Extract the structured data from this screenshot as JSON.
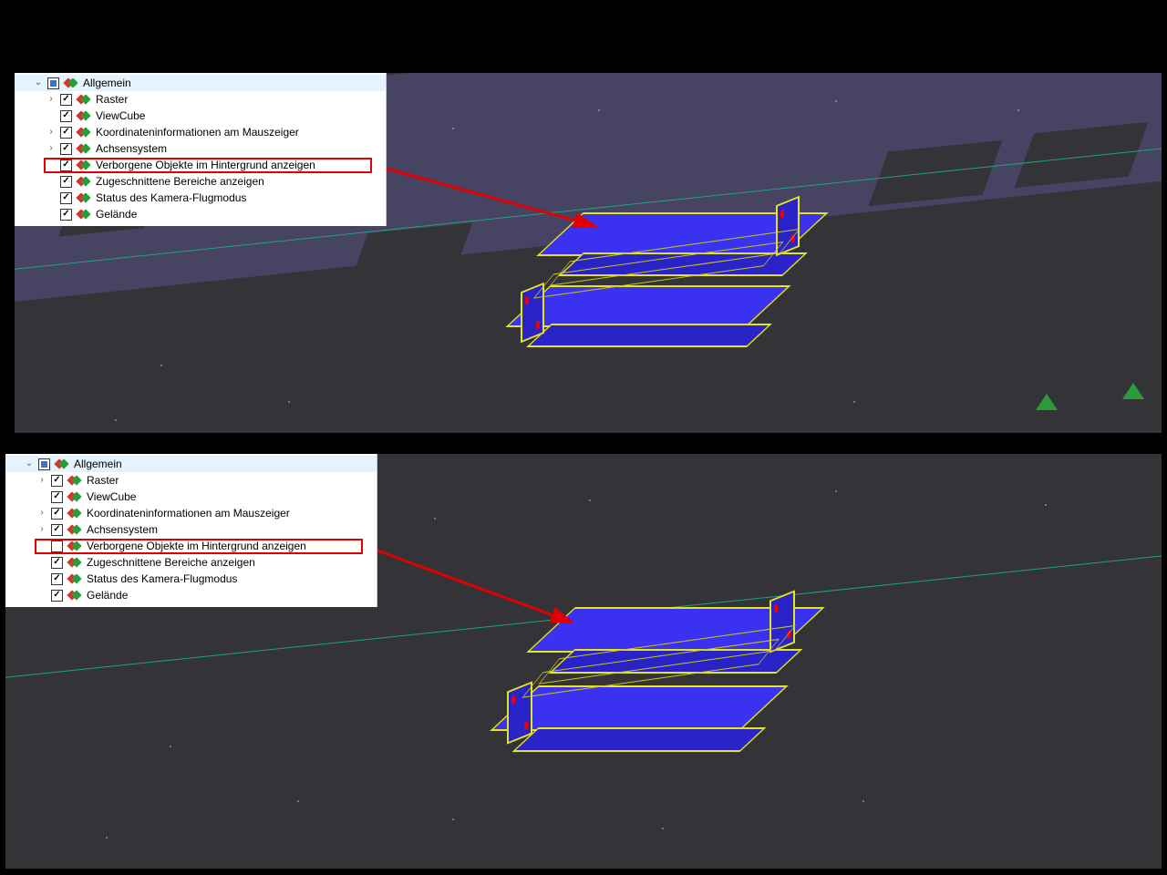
{
  "panels": [
    {
      "id": "top",
      "highlighted_item_index": 5,
      "highlighted_item_checked": true,
      "tree": {
        "root": {
          "label": "Allgemein",
          "checked": "partial"
        },
        "items": [
          {
            "label": "Raster",
            "checked": true,
            "expandable": true
          },
          {
            "label": "ViewCube",
            "checked": true,
            "expandable": false
          },
          {
            "label": "Koordinateninformationen am Mauszeiger",
            "checked": true,
            "expandable": true
          },
          {
            "label": "Achsensystem",
            "checked": true,
            "expandable": true
          },
          {
            "label": "Verborgene Objekte im Hintergrund anzeigen",
            "checked": true,
            "expandable": false
          },
          {
            "label": "Zugeschnittene Bereiche anzeigen",
            "checked": true,
            "expandable": false
          },
          {
            "label": "Status des Kamera-Flugmodus",
            "checked": true,
            "expandable": false
          },
          {
            "label": "Gelände",
            "checked": true,
            "expandable": false
          }
        ]
      }
    },
    {
      "id": "bottom",
      "highlighted_item_index": 5,
      "highlighted_item_checked": false,
      "tree": {
        "root": {
          "label": "Allgemein",
          "checked": "partial"
        },
        "items": [
          {
            "label": "Raster",
            "checked": true,
            "expandable": true
          },
          {
            "label": "ViewCube",
            "checked": true,
            "expandable": false
          },
          {
            "label": "Koordinateninformationen am Mauszeiger",
            "checked": true,
            "expandable": true
          },
          {
            "label": "Achsensystem",
            "checked": true,
            "expandable": true
          },
          {
            "label": "Verborgene Objekte im Hintergrund anzeigen",
            "checked": false,
            "expandable": false
          },
          {
            "label": "Zugeschnittene Bereiche anzeigen",
            "checked": true,
            "expandable": false
          },
          {
            "label": "Status des Kamera-Flugmodus",
            "checked": true,
            "expandable": false
          },
          {
            "label": "Gelände",
            "checked": true,
            "expandable": false
          }
        ]
      }
    }
  ]
}
